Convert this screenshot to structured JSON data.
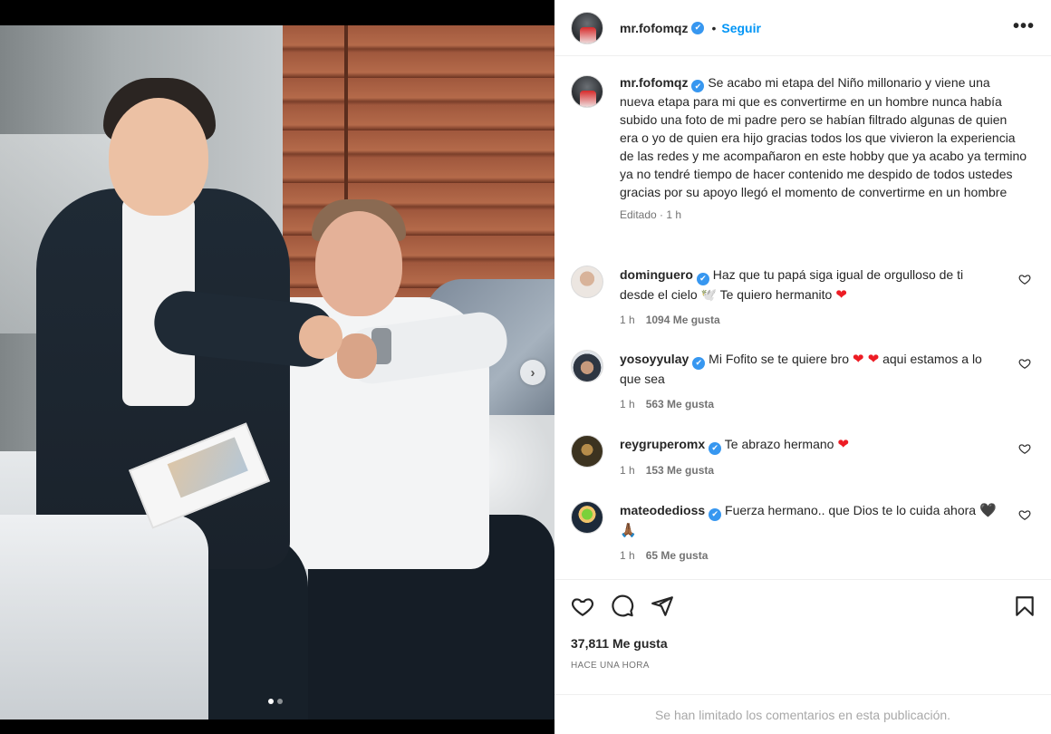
{
  "post": {
    "username": "mr.fofomqz",
    "follow_label": "Seguir",
    "bullet": "•",
    "more_label": "•••"
  },
  "caption": {
    "username": "mr.fofomqz",
    "text": "Se acabo mi etapa del Niño millonario y viene una nueva etapa para mi que es convertirme en un hombre nunca había subido una foto de mi padre pero se habían filtrado algunas de quien era o yo de quien era hijo gracias todos los que vivieron la experiencia de las redes y me acompañaron en este hobby que ya acabo ya termino ya no tendré tiempo de hacer contenido me despido de todos ustedes gracias por su apoyo llegó el momento de convertirme en un hombre",
    "meta": "Editado · 1 h"
  },
  "comments": [
    {
      "username": "dominguero",
      "text": "Haz que tu papá siga igual de orgulloso de ti desde el cielo 🕊️ Te quiero hermanito",
      "text_main": "Haz que tu papá siga igual de orgulloso de ti desde el cielo 🕊️ Te quiero hermanito",
      "emoji_tail": "❤",
      "time": "1 h",
      "likes": "1094 Me gusta",
      "avatar_color": "#e9e3de"
    },
    {
      "username": "yosoyyulay",
      "text_a": "Mi Fofito se te quiere bro",
      "emoji_mid": "❤ ❤",
      "text_b": "aqui estamos a lo que sea",
      "time": "1 h",
      "likes": "563 Me gusta",
      "avatar_color": "#3a4250"
    },
    {
      "username": "reygruperomx",
      "text_main": "Te abrazo hermano",
      "emoji_tail": "❤",
      "time": "1 h",
      "likes": "153 Me gusta",
      "avatar_color": "#4a3d20"
    },
    {
      "username": "mateodedioss",
      "text_main": "Fuerza hermano.. que Dios te lo cuida ahora",
      "emoji_tail": "🖤🙏🏾",
      "time": "1 h",
      "likes": "65 Me gusta",
      "avatar_color": "#1d2a3a"
    }
  ],
  "footer": {
    "likes": "37,811 Me gusta",
    "time": "HACE UNA HORA",
    "limited": "Se han limitado los comentarios en esta publicación."
  },
  "carousel": {
    "current": 1,
    "total": 2
  },
  "colors": {
    "accent": "#0095f6",
    "verified": "#3797f0",
    "heart": "#ed1c24"
  }
}
